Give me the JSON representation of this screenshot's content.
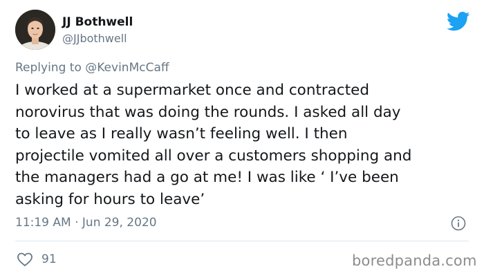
{
  "tweet": {
    "display_name": "JJ Bothwell",
    "handle": "@JJbothwell",
    "reply_prefix": "Replying to",
    "reply_to": "@KevinMcCaff",
    "text": "I worked at a supermarket once and contracted\nnorovirus that was doing the rounds. I asked all day\nto leave as I really wasn’t feeling well. I then\nprojectile vomited all over a customers shopping and\nthe managers had a go at me! I was like ‘ I’ve been\nasking for hours to leave’",
    "timestamp": "11:19 AM · Jun 29, 2020",
    "like_count": "91"
  },
  "watermark": "boredpanda.com",
  "icons": {
    "brand": "twitter-bird-icon",
    "info": "info-icon",
    "like": "heart-icon"
  },
  "colors": {
    "twitter_blue": "#1da1f2",
    "text": "#14171a",
    "secondary_text": "#657786",
    "divider": "#e1e8ed",
    "watermark": "#8c8c8c"
  }
}
